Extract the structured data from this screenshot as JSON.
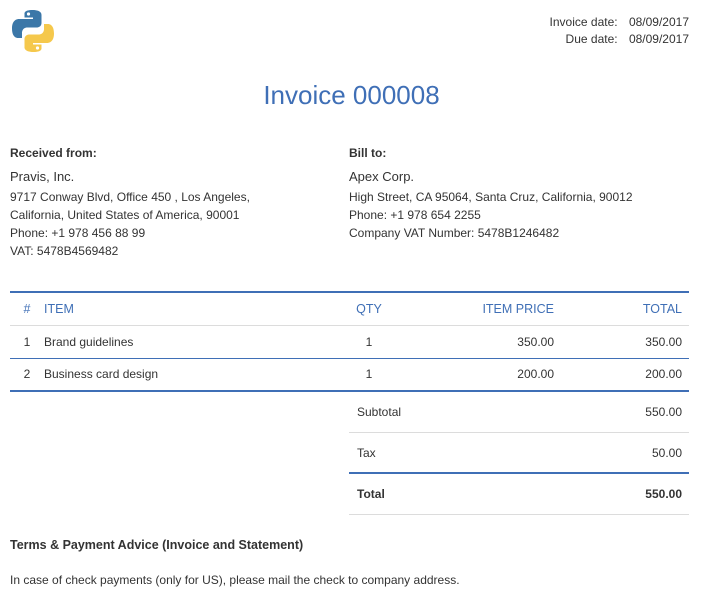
{
  "dates": {
    "invoice_label": "Invoice date:",
    "invoice_value": "08/09/2017",
    "due_label": "Due date:",
    "due_value": "08/09/2017"
  },
  "logo_icon": "python-logo-icon",
  "title": "Invoice 000008",
  "from": {
    "heading": "Received from:",
    "name": "Pravis, Inc.",
    "address1": "9717 Conway Blvd, Office 450 , Los Angeles,",
    "address2": "California, United States of America, 90001",
    "phone": "Phone: +1 978 456 88 99",
    "vat": "VAT: 5478B4569482"
  },
  "to": {
    "heading": "Bill to:",
    "name": "Apex Corp.",
    "address1": "High Street, CA 95064, Santa Cruz, California, 90012",
    "phone": "Phone: +1 978 654 2255",
    "vat": "Company VAT Number: 5478B1246482"
  },
  "table": {
    "headers": {
      "num": "#",
      "item": "ITEM",
      "qty": "QTY",
      "price": "ITEM PRICE",
      "total": "TOTAL"
    },
    "rows": [
      {
        "num": "1",
        "item": "Brand guidelines",
        "qty": "1",
        "price": "350.00",
        "total": "350.00"
      },
      {
        "num": "2",
        "item": "Business card design",
        "qty": "1",
        "price": "200.00",
        "total": "200.00"
      }
    ]
  },
  "summary": {
    "subtotal_label": "Subtotal",
    "subtotal_value": "550.00",
    "tax_label": "Tax",
    "tax_value": "50.00",
    "total_label": "Total",
    "total_value": "550.00"
  },
  "terms": {
    "heading": "Terms & Payment Advice (Invoice and Statement)",
    "text": "In case of check payments (only for US), please mail the check to company address."
  },
  "colors": {
    "accent": "#3f6fb6",
    "python_blue": "#3b77a8",
    "python_yellow": "#f5c84c"
  }
}
